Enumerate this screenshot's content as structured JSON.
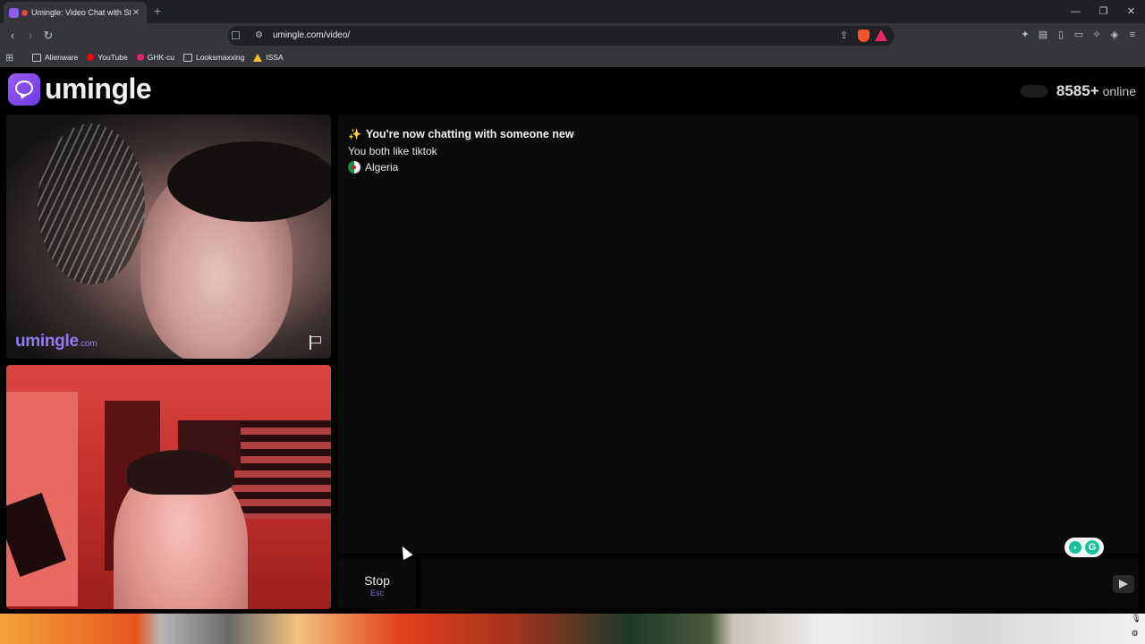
{
  "browser": {
    "tab_title": "Umingle: Video Chat with St",
    "url": "umingle.com/video/",
    "bookmarks": [
      "Alienware",
      "YouTube",
      "GHK-cu",
      "Looksmaxxing",
      "ISSA"
    ]
  },
  "site": {
    "logo_text": "umingle",
    "online_count": "8585+",
    "online_label": "online"
  },
  "remote_video": {
    "watermark": "umingle",
    "watermark_suffix": ".com"
  },
  "chat": {
    "messages": [
      "You're now chatting with someone new",
      "You both like tiktok",
      "Algeria"
    ]
  },
  "controls": {
    "stop_label": "Stop",
    "stop_key": "Esc",
    "message_value": ""
  },
  "colors": {
    "brand_purple": "#8b5cf6",
    "accent_key": "#7f6bf0",
    "grammarly": "#15c39a"
  }
}
